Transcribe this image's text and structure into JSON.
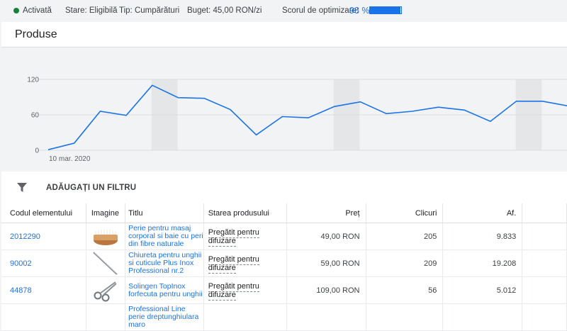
{
  "status_bar": {
    "status": "Activată",
    "state": "Stare: Eligibilă",
    "type": "Tip: Cumpărături",
    "budget": "Buget: 45,00 RON/zi",
    "score_label": "Scorul de optimizare:",
    "score_value": "98 %",
    "score_fraction": 0.98,
    "status_color": "#188038",
    "accent_color": "#1a73e8"
  },
  "page": {
    "title": "Produse"
  },
  "chart_data": {
    "type": "line",
    "x_start_label": "10 mar. 2020",
    "yticks": [
      0,
      60,
      120
    ],
    "ylim": [
      0,
      120
    ],
    "values": [
      1,
      12,
      66,
      59,
      110,
      89,
      88,
      69,
      26,
      57,
      55,
      74,
      82,
      62,
      66,
      73,
      68,
      49,
      83,
      83,
      75
    ],
    "highlighted_points": [
      4,
      11,
      18
    ],
    "line_color": "#1a73e8"
  },
  "filter": {
    "label": "ADĂUGAȚI UN FILTRU"
  },
  "table": {
    "headers": {
      "id": "Codul elementului",
      "image": "Imagine",
      "title": "Titlu",
      "state": "Starea produsului",
      "price": "Preț",
      "clicks": "Clicuri",
      "af": "Af."
    },
    "rows": [
      {
        "id": "2012290",
        "image": "brush-product-image",
        "title": "Perie pentru masaj corporal si baie cu peri din fibre naturale",
        "state": "Pregătit pentru difuzare",
        "price": "49,00 RON",
        "clicks": "205",
        "af": "9.833"
      },
      {
        "id": "90002",
        "image": "nail-file-product-image",
        "title": "Chiureta pentru unghii si cuticule Plus Inox Professional nr.2",
        "state": "Pregătit pentru difuzare",
        "price": "59,00 RON",
        "clicks": "209",
        "af": "19.208"
      },
      {
        "id": "44878",
        "image": "nail-scissors-product-image",
        "title": "Solingen TopInox forfecuta pentru unghii",
        "state": "Pregătit pentru difuzare",
        "price": "109,00 RON",
        "clicks": "56",
        "af": "5.012"
      },
      {
        "id": "",
        "image": "",
        "title": "Professional Line perie dreptunghiulara maro",
        "state": "",
        "price": "",
        "clicks": "",
        "af": ""
      }
    ]
  }
}
